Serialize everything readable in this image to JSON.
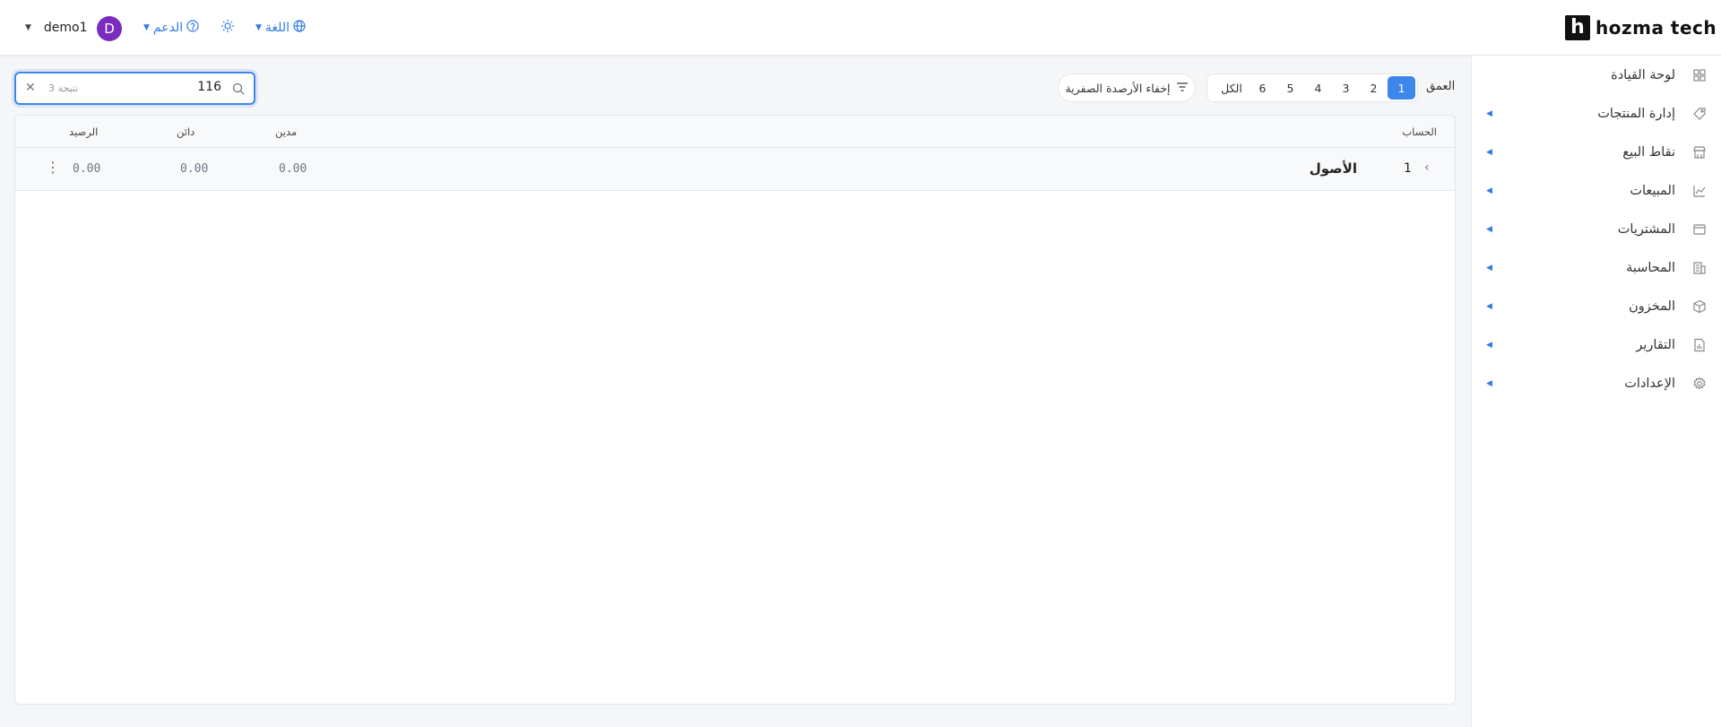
{
  "app": {
    "logo_mark": "h",
    "logo_text": "hozma tech"
  },
  "topbar": {
    "language_label": "اللغة",
    "support_label": "الدعم",
    "user_name": "demo1",
    "avatar_letter": "D"
  },
  "sidebar": {
    "items": [
      {
        "label": "لوحة القيادة",
        "icon": "dashboard-icon",
        "has_submenu": false
      },
      {
        "label": "إدارة المنتجات",
        "icon": "tag-icon",
        "has_submenu": true
      },
      {
        "label": "نقاط البيع",
        "icon": "store-icon",
        "has_submenu": true
      },
      {
        "label": "المبيعات",
        "icon": "line-chart-icon",
        "has_submenu": true
      },
      {
        "label": "المشتريات",
        "icon": "wallet-icon",
        "has_submenu": true
      },
      {
        "label": "المحاسبة",
        "icon": "ledger-icon",
        "has_submenu": true
      },
      {
        "label": "المخزون",
        "icon": "box-icon",
        "has_submenu": true
      },
      {
        "label": "التقارير",
        "icon": "report-icon",
        "has_submenu": true
      },
      {
        "label": "الإعدادات",
        "icon": "gear-icon",
        "has_submenu": true
      }
    ]
  },
  "toolbar": {
    "depth_label": "العمق",
    "depth_options": [
      "1",
      "2",
      "3",
      "4",
      "5",
      "6",
      "الكل"
    ],
    "depth_selected": "1",
    "hide_zero_label": "إخفاء الأرصدة الصفرية",
    "search_value": "116",
    "search_result_count": "3 نتيجة"
  },
  "table": {
    "columns": {
      "account": "الحساب",
      "debit": "مدين",
      "credit": "دائن",
      "balance": "الرصيد"
    },
    "rows": [
      {
        "code": "1",
        "name": "الأصول",
        "debit": "0.00",
        "credit": "0.00",
        "balance": "0.00"
      }
    ]
  },
  "colors": {
    "accent": "#3d86ea",
    "avatar": "#7b2bbd"
  }
}
